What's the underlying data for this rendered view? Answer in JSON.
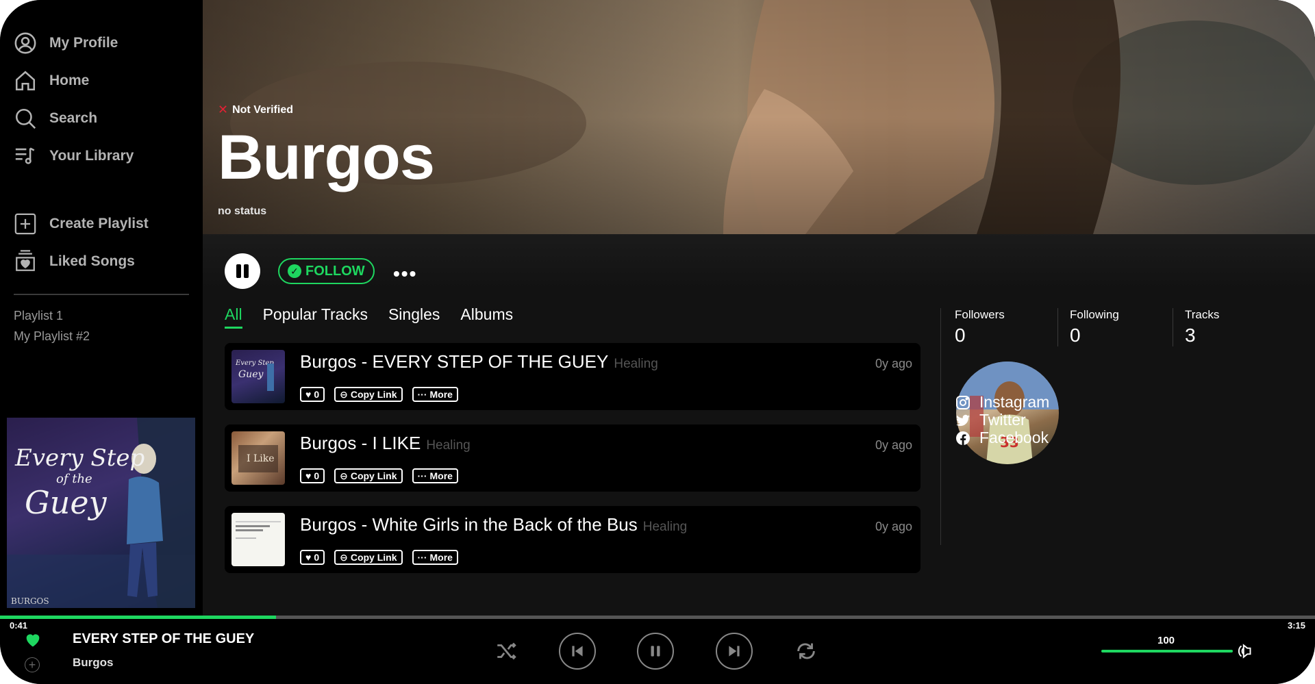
{
  "sidebar": {
    "nav": [
      {
        "label": "My Profile",
        "icon": "profile-icon"
      },
      {
        "label": "Home",
        "icon": "home-icon"
      },
      {
        "label": "Search",
        "icon": "search-icon"
      },
      {
        "label": "Your Library",
        "icon": "library-icon"
      }
    ],
    "actions": [
      {
        "label": "Create Playlist",
        "icon": "plus-square-icon"
      },
      {
        "label": "Liked Songs",
        "icon": "heart-box-icon"
      }
    ],
    "playlists": [
      "Playlist 1",
      "My Playlist #2"
    ]
  },
  "artist": {
    "verified_label": "Not Verified",
    "name": "Burgos",
    "status": "no status",
    "follow_label": "FOLLOW"
  },
  "tabs": [
    "All",
    "Popular Tracks",
    "Singles",
    "Albums"
  ],
  "tracks": [
    {
      "title": "Burgos - EVERY STEP OF THE GUEY",
      "genre": "Healing",
      "time": "0y ago",
      "likes": "0",
      "copy_label": "Copy Link",
      "more_label": "More"
    },
    {
      "title": "Burgos - I LIKE",
      "genre": "Healing",
      "time": "0y ago",
      "likes": "0",
      "copy_label": "Copy Link",
      "more_label": "More"
    },
    {
      "title": "Burgos - White Girls in the Back of the Bus",
      "genre": "Healing",
      "time": "0y ago",
      "likes": "0",
      "copy_label": "Copy Link",
      "more_label": "More"
    }
  ],
  "stats": {
    "followers_label": "Followers",
    "followers": "0",
    "following_label": "Following",
    "following": "0",
    "tracks_label": "Tracks",
    "tracks": "3"
  },
  "socials": [
    {
      "label": "Instagram",
      "icon": "instagram-icon"
    },
    {
      "label": "Twitter",
      "icon": "twitter-icon"
    },
    {
      "label": "Facebook",
      "icon": "facebook-icon"
    }
  ],
  "player": {
    "time_now": "0:41",
    "time_total": "3:15",
    "title": "EVERY STEP OF THE GUEY",
    "artist": "Burgos",
    "volume": "100",
    "progress_fraction": 0.21
  },
  "colors": {
    "accent": "#1ed760",
    "background": "#121212",
    "card": "#000000",
    "not_verified": "#e22134"
  }
}
